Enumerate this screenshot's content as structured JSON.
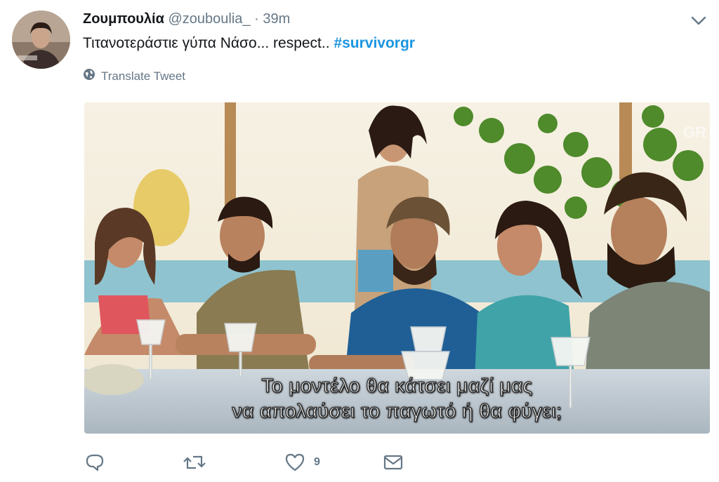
{
  "tweet": {
    "author_name": "Ζουμπουλία",
    "handle": "@zouboulia_",
    "separator": "·",
    "time": "39m",
    "text": "Τιτανοτεράστιε γύπα Νάσο... respect.. ",
    "hashtag": "#survivorgr",
    "translate_label": "Translate Tweet"
  },
  "media": {
    "subtitle_line1": "Το μοντέλο θα κάτσει μαζί μας",
    "subtitle_line2": "να απολαύσει το παγωτό ή θα φύγει;",
    "watermark": "GR"
  },
  "actions": {
    "reply_icon": "reply-icon",
    "retweet_icon": "retweet-icon",
    "like_icon": "heart-icon",
    "like_count": "9",
    "message_icon": "envelope-icon"
  },
  "colors": {
    "link": "#1b95e0",
    "muted": "#657786",
    "text": "#14171a"
  }
}
